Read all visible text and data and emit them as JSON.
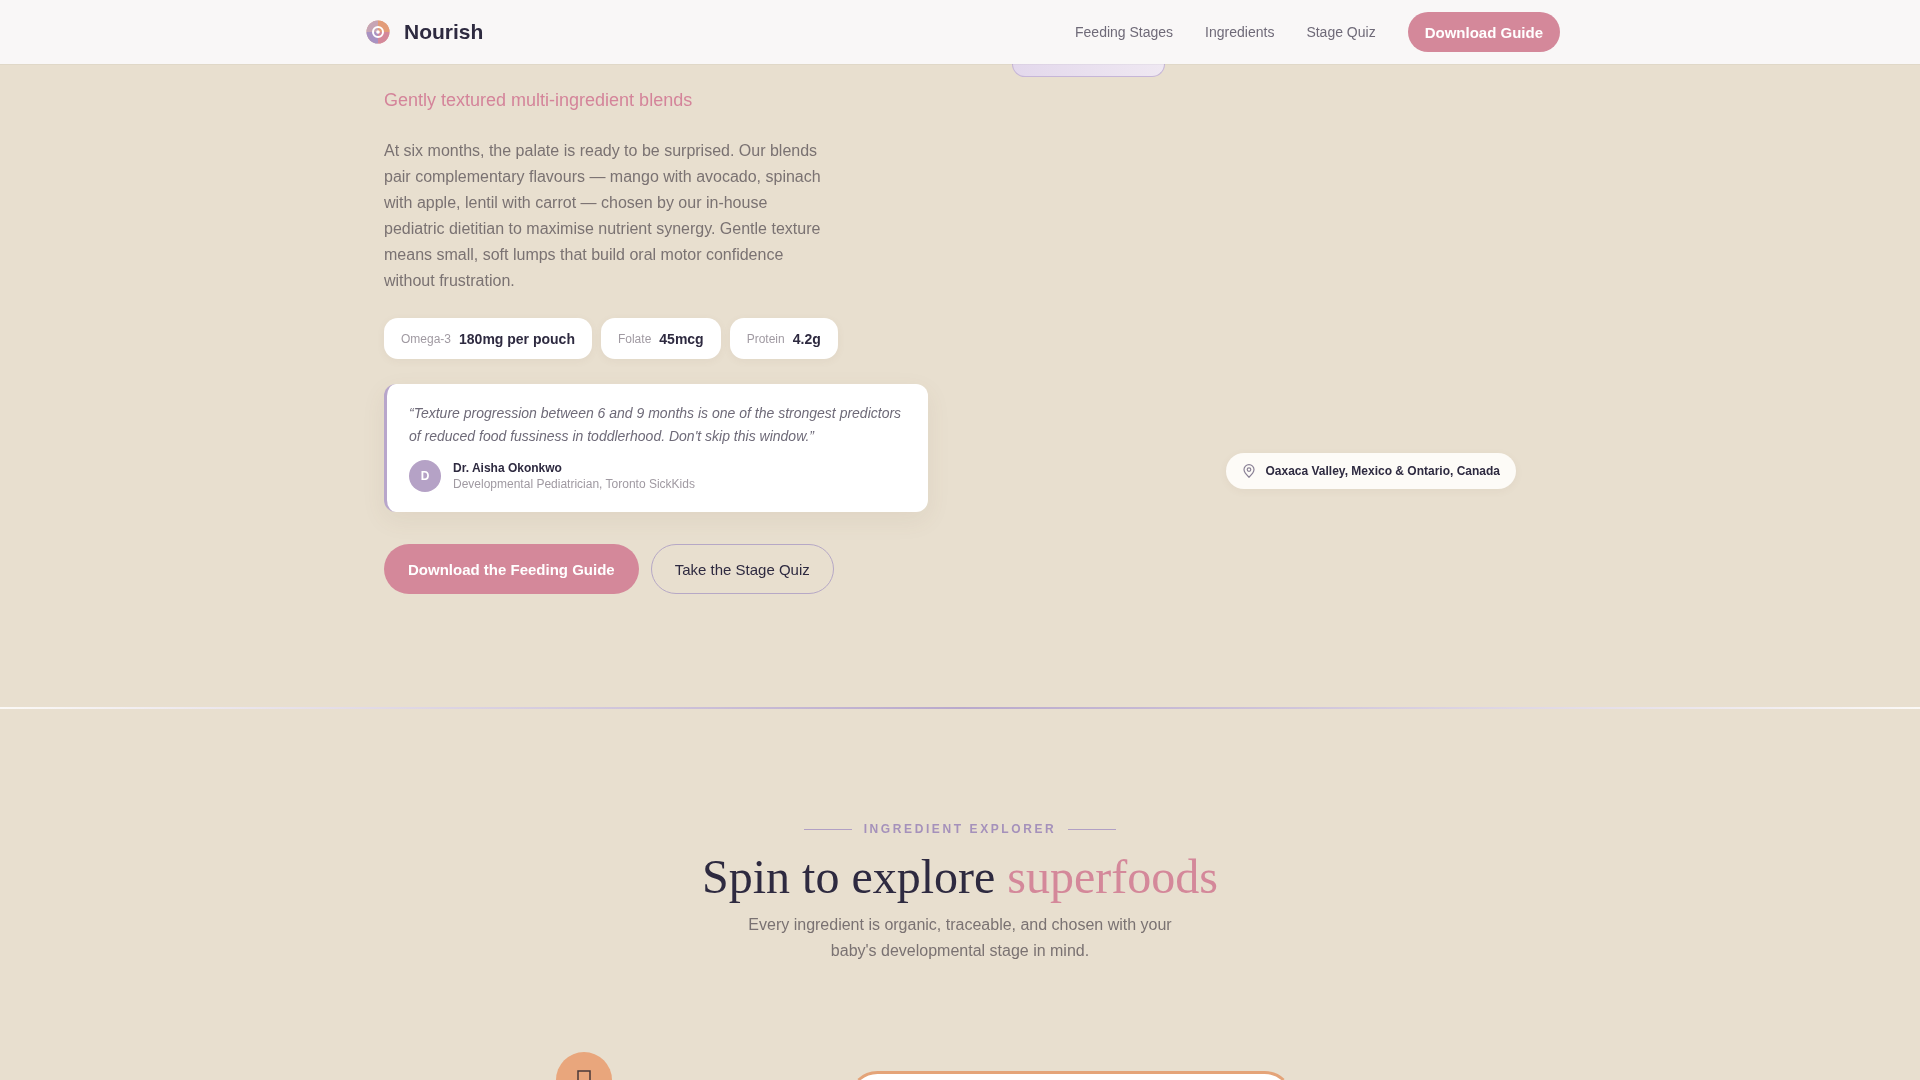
{
  "header": {
    "brand": "Nourish",
    "nav": [
      {
        "label": "Feeding Stages"
      },
      {
        "label": "Ingredients"
      },
      {
        "label": "Stage Quiz"
      }
    ],
    "cta": "Download Guide"
  },
  "hero": {
    "subtitle": "Gently textured multi-ingredient blends",
    "body": "At six months, the palate is ready to be surprised. Our blends pair complementary flavours — mango with avocado, spinach with apple, lentil with carrot — chosen by our in-house pediatric dietitian to maximise nutrient synergy. Gentle texture means small, soft lumps that build oral motor confidence without frustration.",
    "nutrients": [
      {
        "label": "Omega-3",
        "value": "180mg per pouch"
      },
      {
        "label": "Folate",
        "value": "45mcg"
      },
      {
        "label": "Protein",
        "value": "4.2g"
      }
    ],
    "quote": {
      "text": "“Texture progression between 6 and 9 months is one of the strongest predictors of reduced food fussiness in toddlerhood. Don't skip this window.”",
      "avatar": "D",
      "name": "Dr. Aisha Okonkwo",
      "role": "Developmental Pediatrician, Toronto SickKids"
    },
    "buttons": [
      {
        "label": "Download the Feeding Guide",
        "kind": "primary"
      },
      {
        "label": "Take the Stage Quiz",
        "kind": "secondary"
      }
    ],
    "origin": "Oaxaca Valley, Mexico & Ontario, Canada"
  },
  "explorer": {
    "eyebrow": "INGREDIENT EXPLORER",
    "heading": "Spin to explore",
    "heading_accent": "superfoods",
    "description": "Every ingredient is organic, traceable, and chosen with your baby's developmental stage in mind."
  }
}
